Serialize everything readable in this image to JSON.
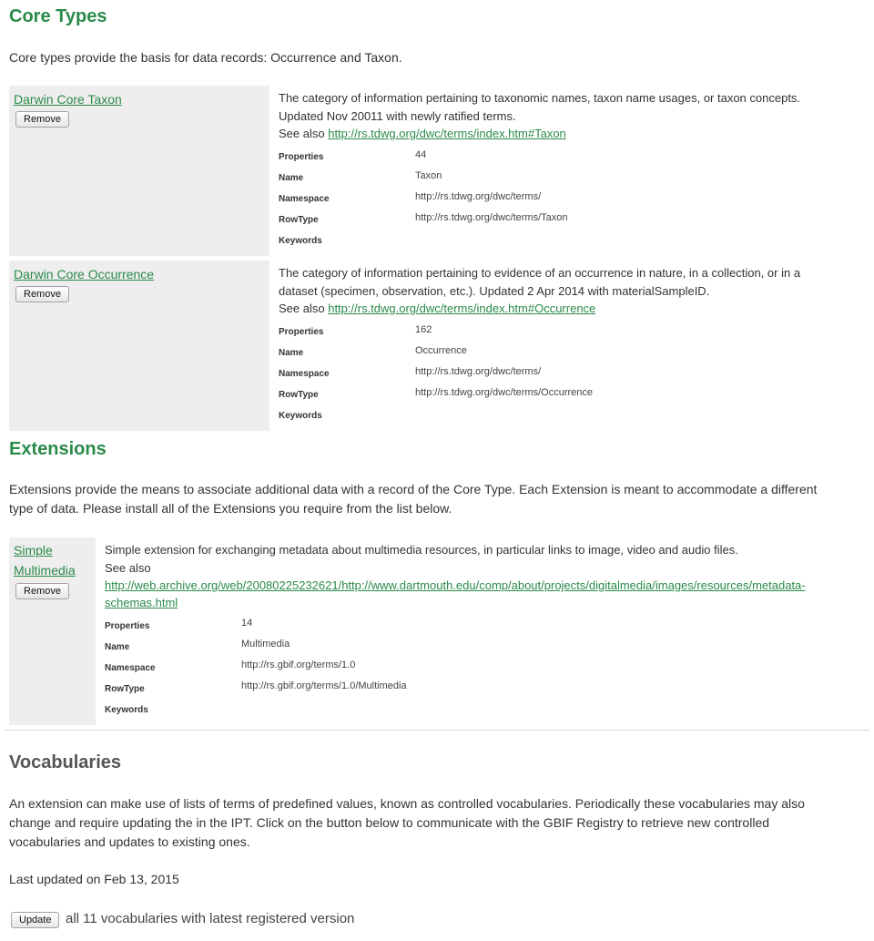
{
  "core": {
    "title": "Core Types",
    "intro": "Core types provide the basis for data records: Occurrence and Taxon.",
    "items": [
      {
        "name": "Darwin Core Taxon",
        "remove_label": "Remove",
        "description": "The category of information pertaining to taxonomic names, taxon name usages, or taxon concepts. Updated Nov 20011 with newly ratified terms.",
        "see_also_label": "See also",
        "see_also_link": "http://rs.tdwg.org/dwc/terms/index.htm#Taxon",
        "labels": {
          "properties": "Properties",
          "name": "Name",
          "namespace": "Namespace",
          "rowtype": "RowType",
          "keywords": "Keywords"
        },
        "properties": "44",
        "prop_name": "Taxon",
        "namespace": "http://rs.tdwg.org/dwc/terms/",
        "rowtype": "http://rs.tdwg.org/dwc/terms/Taxon",
        "keywords": ""
      },
      {
        "name": "Darwin Core Occurrence",
        "remove_label": "Remove",
        "description": "The category of information pertaining to evidence of an occurrence in nature, in a collection, or in a dataset (specimen, observation, etc.). Updated 2 Apr 2014 with materialSampleID.",
        "see_also_label": "See also",
        "see_also_link": "http://rs.tdwg.org/dwc/terms/index.htm#Occurrence",
        "labels": {
          "properties": "Properties",
          "name": "Name",
          "namespace": "Namespace",
          "rowtype": "RowType",
          "keywords": "Keywords"
        },
        "properties": "162",
        "prop_name": "Occurrence",
        "namespace": "http://rs.tdwg.org/dwc/terms/",
        "rowtype": "http://rs.tdwg.org/dwc/terms/Occurrence",
        "keywords": ""
      }
    ]
  },
  "extensions": {
    "title": "Extensions",
    "intro": "Extensions provide the means to associate additional data with a record of the Core Type. Each Extension is meant to accommodate a different type of data. Please install all of the Extensions you require from the list below.",
    "items": [
      {
        "name_line1": "Simple",
        "name_line2": "Multimedia",
        "remove_label": "Remove",
        "description": "Simple extension for exchanging metadata about multimedia resources, in particular links to image, video and audio files.",
        "see_also_label": "See also",
        "see_also_link_line1": "http://web.archive.org/web/20080225232621/http://www.dartmouth.edu/comp/about/projects/digitalmedia/images/resources/metadata-",
        "see_also_link_line2": "schemas.html",
        "labels": {
          "properties": "Properties",
          "name": "Name",
          "namespace": "Namespace",
          "rowtype": "RowType",
          "keywords": "Keywords"
        },
        "properties": "14",
        "prop_name": "Multimedia",
        "namespace": "http://rs.gbif.org/terms/1.0",
        "rowtype": "http://rs.gbif.org/terms/1.0/Multimedia",
        "keywords": ""
      }
    ]
  },
  "vocabularies": {
    "title": "Vocabularies",
    "intro": "An extension can make use of lists of terms of predefined values, known as controlled vocabularies. Periodically these vocabularies may also change and require updating the in the IPT. Click on the button below to communicate with the GBIF Registry to retrieve new controlled vocabularies and updates to existing ones.",
    "last_updated": "Last updated on Feb 13, 2015",
    "update_label": "Update",
    "update_text": "all 11 vocabularies with latest registered version"
  },
  "colors": {
    "accent": "#2a8a4a",
    "panel": "#eeeeee",
    "text": "#333333"
  }
}
